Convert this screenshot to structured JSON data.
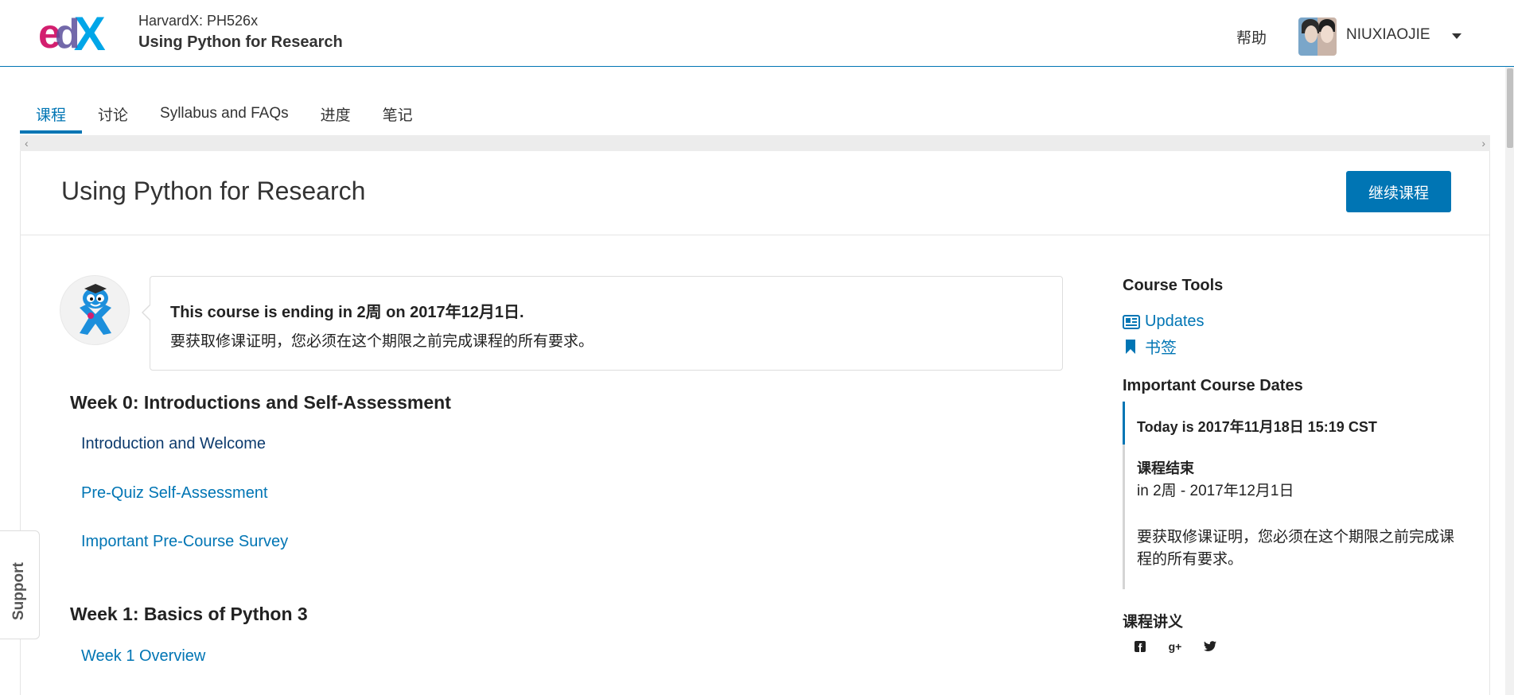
{
  "header": {
    "logo_text": "edX",
    "course_org": "HarvardX: PH526x",
    "course_name": "Using Python for Research",
    "help_label": "帮助",
    "username": "NIUXIAOJIE"
  },
  "tabs": [
    {
      "label": "课程",
      "active": true
    },
    {
      "label": "讨论",
      "active": false
    },
    {
      "label": "Syllabus and FAQs",
      "active": false
    },
    {
      "label": "进度",
      "active": false
    },
    {
      "label": "笔记",
      "active": false
    }
  ],
  "scroller": {
    "left_arrow": "‹",
    "right_arrow": "›"
  },
  "page": {
    "title": "Using Python for Research",
    "resume_button": "继续课程"
  },
  "welcome": {
    "line1": "This course is ending in 2周 on 2017年12月1日.",
    "line2": "要获取修课证明，您必须在这个期限之前完成课程的所有要求。"
  },
  "outline": [
    {
      "title": "Week 0: Introductions and Self-Assessment",
      "subsections": [
        {
          "label": "Introduction and Welcome",
          "visited": true
        },
        {
          "label": "Pre-Quiz Self-Assessment",
          "visited": false
        },
        {
          "label": "Important Pre-Course Survey",
          "visited": false
        }
      ]
    },
    {
      "title": "Week 1: Basics of Python 3",
      "subsections": [
        {
          "label": "Week 1 Overview",
          "visited": false
        }
      ]
    }
  ],
  "sidebar": {
    "tools_heading": "Course Tools",
    "tools": [
      {
        "label": "Updates",
        "icon": "newspaper-icon"
      },
      {
        "label": "书签",
        "icon": "bookmark-icon"
      }
    ],
    "dates_heading": "Important Course Dates",
    "today": "Today is 2017年11月18日 15:19 CST",
    "end_label": "课程结束",
    "end_value": "in 2周 - 2017年12月1日",
    "end_description": "要获取修课证明，您必须在这个期限之前完成课程的所有要求。",
    "handouts_heading": "课程讲义",
    "social": [
      {
        "icon": "facebook-icon",
        "glyph": "f"
      },
      {
        "icon": "google-plus-icon",
        "glyph": "g+"
      },
      {
        "icon": "twitter-icon",
        "glyph": "t"
      }
    ]
  },
  "support_tab": {
    "label": "Support"
  },
  "colors": {
    "accent": "#0075b4",
    "visited_link": "#0d3b6e",
    "logo_e": "#d31f6f",
    "logo_x": "#00a6e8"
  }
}
